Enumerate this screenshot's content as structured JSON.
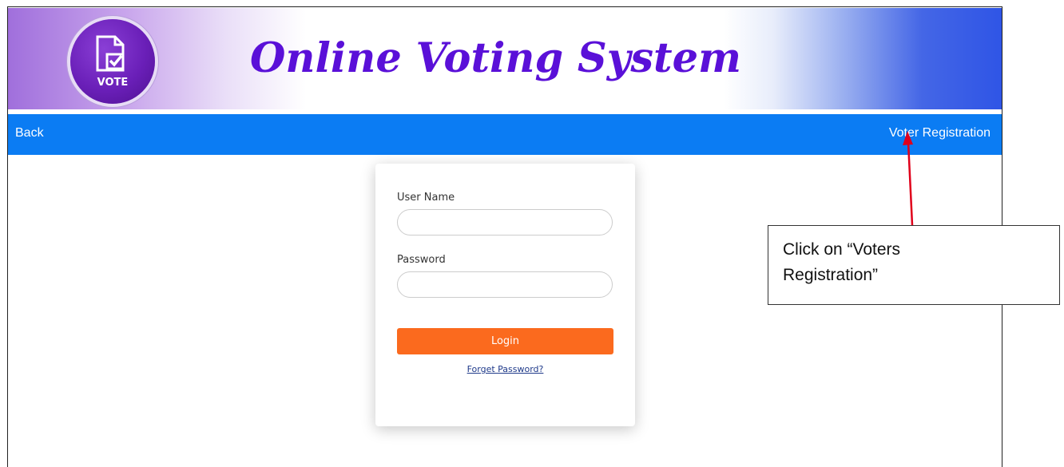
{
  "header": {
    "logo_text": "VOTE",
    "title": "Online Voting System"
  },
  "nav": {
    "back_label": "Back",
    "register_label": "Voter Registration"
  },
  "login": {
    "username_label": "User Name",
    "username_value": "",
    "password_label": "Password",
    "password_value": "",
    "login_button": "Login",
    "forgot_link": "Forget Password?"
  },
  "annotation": {
    "text": "Click on “Voters Registration”"
  },
  "colors": {
    "navbar": "#0b7cf3",
    "title": "#5a10d8",
    "login_button": "#fb6a1e",
    "arrow": "#e0001b"
  }
}
